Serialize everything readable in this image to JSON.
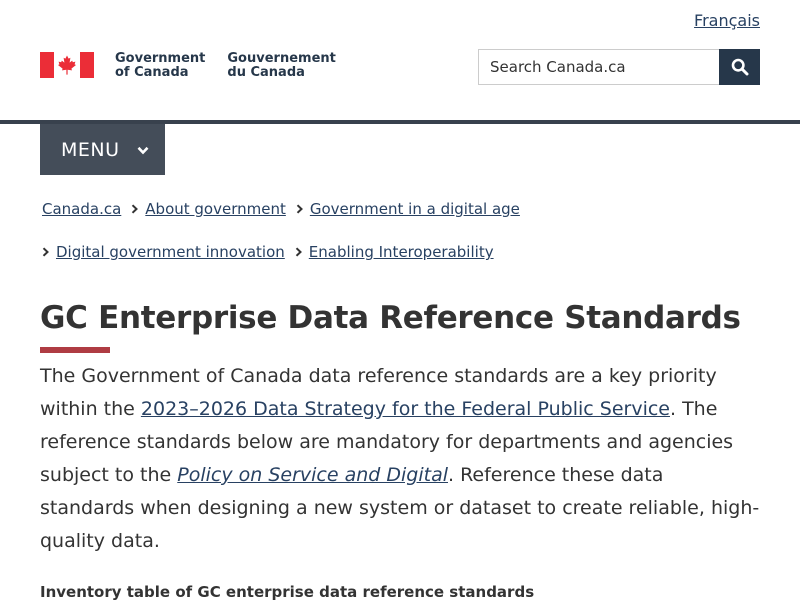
{
  "header": {
    "language_link": "Français",
    "wordmark_en": [
      "Government",
      "of Canada"
    ],
    "wordmark_fr": [
      "Gouvernement",
      "du Canada"
    ],
    "search": {
      "placeholder": "Search Canada.ca",
      "button_icon": "search-icon"
    },
    "flag_colors": {
      "red": "#eb2d37"
    }
  },
  "menu": {
    "label": "MENU",
    "icon": "chevron-down-icon"
  },
  "breadcrumbs": {
    "row1": [
      "Canada.ca",
      "About government",
      "Government in a digital age"
    ],
    "row2": [
      "Digital government innovation",
      "Enabling Interoperability"
    ]
  },
  "main": {
    "title": "GC Enterprise Data Reference Standards",
    "intro": {
      "part1": "The Government of Canada data reference standards are a key priority within the ",
      "link1": "2023–2026 Data Strategy for the Federal Public Service",
      "part2": ". The reference standards below are mandatory for departments and agencies subject to the ",
      "link2": "Policy on Service and Digital",
      "part3": ". Reference these data standards when designing a new system or dataset to create reliable, high-quality data."
    },
    "table_caption": "Inventory table of GC enterprise data reference standards"
  },
  "colors": {
    "link": "#284162",
    "menu_bg": "#444d59",
    "search_button": "#26374a",
    "title_accent": "#af3c43",
    "header_rule": "#38414d"
  }
}
